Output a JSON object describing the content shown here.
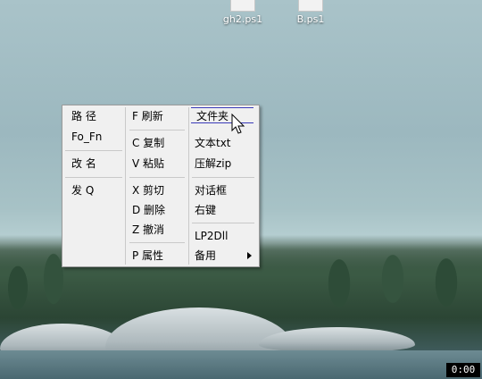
{
  "desktop": {
    "icons": [
      {
        "label": "gh2.ps1"
      },
      {
        "label": "B.ps1"
      }
    ]
  },
  "context_menu": {
    "col1": [
      "路 径",
      "Fo_Fn",
      "改 名",
      "发 Q"
    ],
    "col2": [
      "F 刷新",
      "C 复制",
      "V 粘贴",
      "X 剪切",
      "D 删除",
      "Z 撤消",
      "P 属性"
    ],
    "col3": [
      "文件夹",
      "文本txt",
      "压解zip",
      "对话框",
      "右键",
      "LP2Dll",
      "备用"
    ],
    "highlighted": "文件夹",
    "submenu_item": "备用"
  },
  "recorder": {
    "timer": "0:00"
  },
  "colors": {
    "menu_bg": "#f0f0f0",
    "highlight_border": "#3a3ab8"
  }
}
